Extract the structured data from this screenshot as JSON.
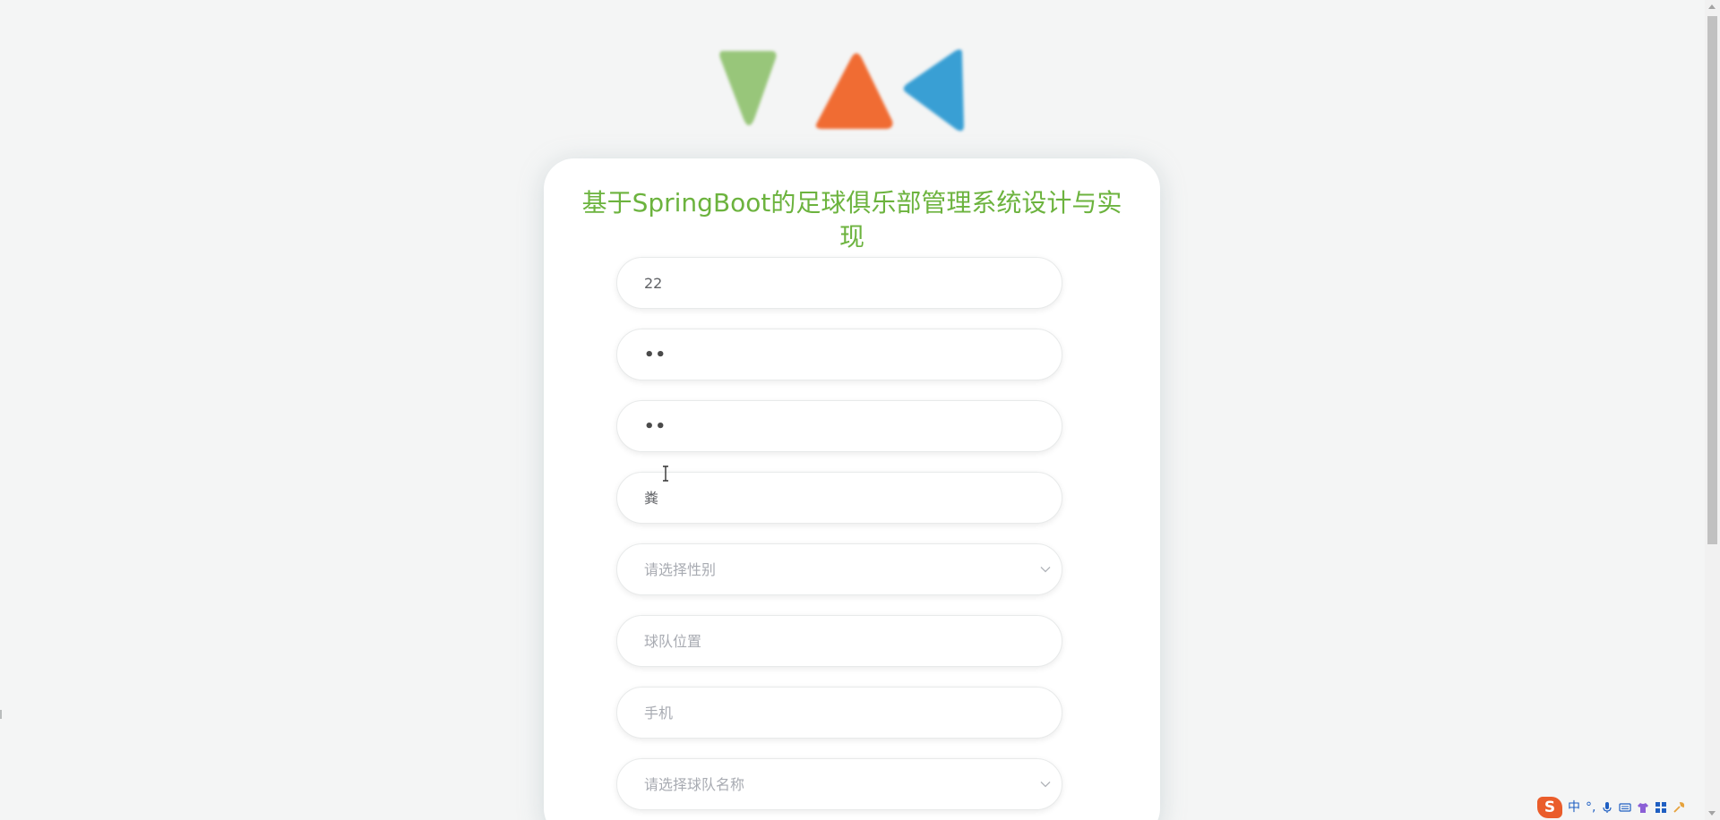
{
  "title_lines": [
    "基于SpringBoot的足球俱乐部管理系统设计与实",
    "现"
  ],
  "form": {
    "account": {
      "value": "22"
    },
    "password": {
      "value": "••"
    },
    "confirm_password": {
      "value": "••"
    },
    "name": {
      "value": "粪"
    },
    "gender": {
      "placeholder": "请选择性别"
    },
    "position": {
      "placeholder": "球队位置"
    },
    "phone": {
      "placeholder": "手机"
    },
    "team": {
      "placeholder": "请选择球队名称"
    }
  },
  "ime": {
    "logo": "S",
    "mode": "中",
    "punct": "°,"
  },
  "colors": {
    "title": "#6cb33e",
    "triangle_green": "#98c67a",
    "triangle_orange": "#f06c33",
    "triangle_blue": "#399fd4"
  },
  "icons": [
    "chevron-down-icon",
    "text-cursor-icon",
    "microphone-icon",
    "keyboard-icon",
    "shirt-icon",
    "grid-icon",
    "tools-icon"
  ]
}
